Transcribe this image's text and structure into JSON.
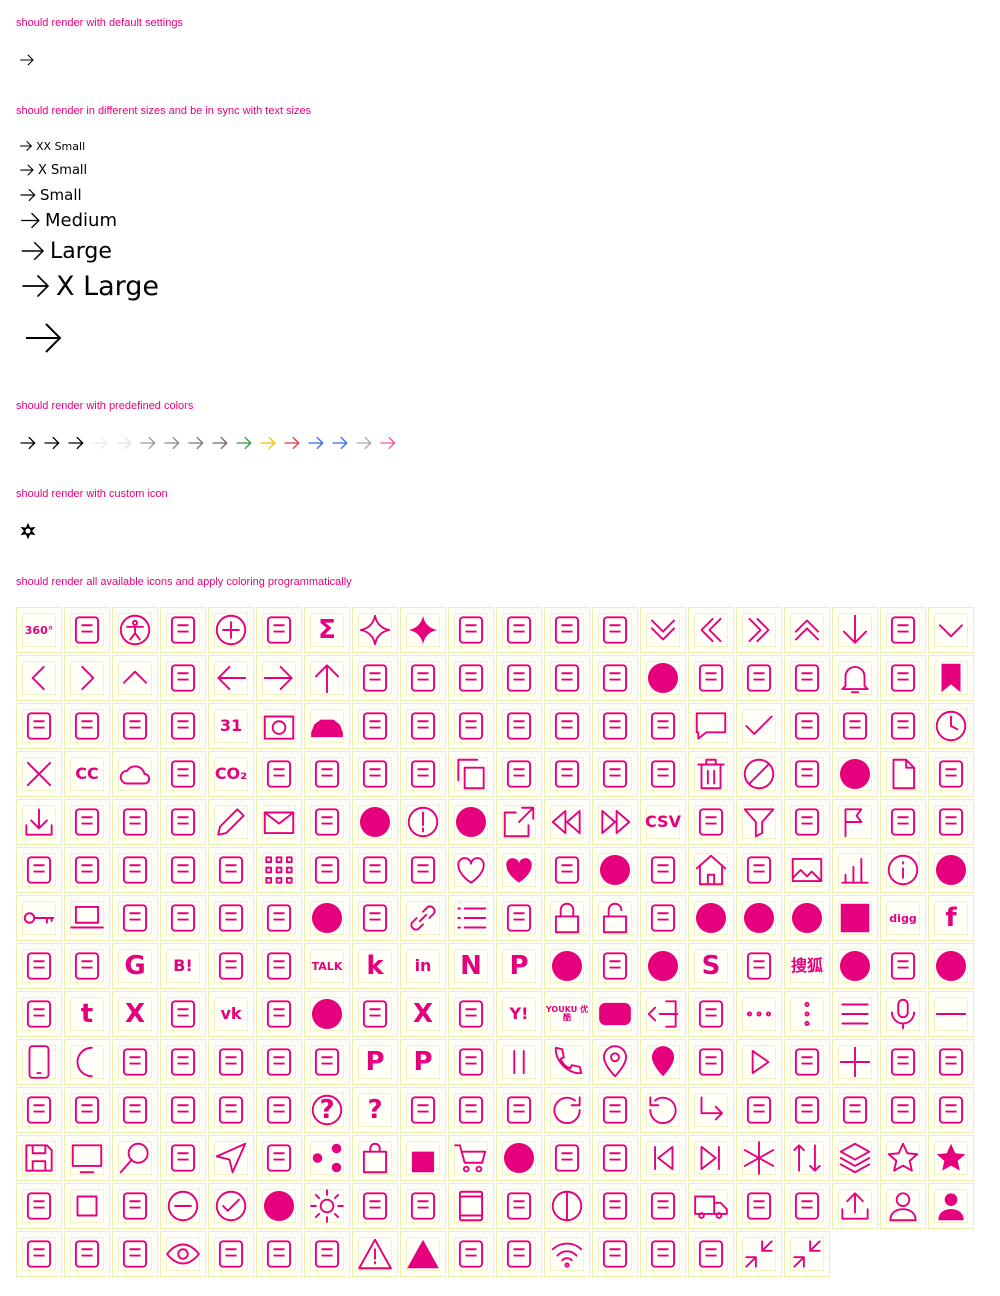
{
  "sections": {
    "default": "should render with default settings",
    "sizes": "should render in different sizes and be in sync with text sizes",
    "colors": "should render with predefined colors",
    "custom": "should render with custom icon",
    "all": "should render all available icons and apply coloring programmatically"
  },
  "size_labels": [
    "XX Small",
    "X Small",
    "Small",
    "Medium",
    "Large",
    "X Large",
    ""
  ],
  "predefined_colors": [
    "#000000",
    "#000000",
    "#000000",
    "#ececec",
    "#e2e2e2",
    "#9a9a9a",
    "#8a8a8a",
    "#7a7a7a",
    "#6a6a6a",
    "#2f9e3c",
    "#e6c700",
    "#e5354b",
    "#2f6bef",
    "#2f6bef",
    "#a9a9a9",
    "#ff4f9a"
  ],
  "accent_color": "#e6007e",
  "icons": [
    {
      "name": "360-icon",
      "text": "360°"
    },
    {
      "name": "accessibility-beam-icon",
      "text": ""
    },
    {
      "name": "accessibility-icon",
      "text": ""
    },
    {
      "name": "air-fan-icon",
      "text": ""
    },
    {
      "name": "add-icon",
      "text": ""
    },
    {
      "name": "adjust-icon",
      "text": ""
    },
    {
      "name": "sigma-icon",
      "text": "Σ"
    },
    {
      "name": "sparkle-icon",
      "text": ""
    },
    {
      "name": "sparkle-filled-icon",
      "text": ""
    },
    {
      "name": "arrow-head-down-icon",
      "text": ""
    },
    {
      "name": "arrow-head-left-icon",
      "text": ""
    },
    {
      "name": "arrow-head-right-icon",
      "text": ""
    },
    {
      "name": "arrow-head-up-icon",
      "text": ""
    },
    {
      "name": "arrow-double-down-icon",
      "text": ""
    },
    {
      "name": "arrow-double-left-icon",
      "text": ""
    },
    {
      "name": "arrow-double-right-icon",
      "text": ""
    },
    {
      "name": "arrow-double-up-icon",
      "text": ""
    },
    {
      "name": "arrow-down-icon",
      "text": ""
    },
    {
      "name": "arrow-first-icon",
      "text": ""
    },
    {
      "name": "arrow-head-down-outline-icon",
      "text": ""
    },
    {
      "name": "arrow-head-left-outline-icon",
      "text": ""
    },
    {
      "name": "arrow-head-right-outline-icon",
      "text": ""
    },
    {
      "name": "arrow-head-up-outline-icon",
      "text": ""
    },
    {
      "name": "arrow-last-icon",
      "text": ""
    },
    {
      "name": "arrow-left-icon",
      "text": ""
    },
    {
      "name": "arrow-right-icon",
      "text": ""
    },
    {
      "name": "arrow-up-icon",
      "text": ""
    },
    {
      "name": "arrows-icon",
      "text": ""
    },
    {
      "name": "attachment-icon",
      "text": ""
    },
    {
      "name": "augmented-reality-icon",
      "text": ""
    },
    {
      "name": "battery-empty-icon",
      "text": ""
    },
    {
      "name": "battery-level-icon",
      "text": ""
    },
    {
      "name": "battery-charging-icon",
      "text": ""
    },
    {
      "name": "battery-full-icon",
      "text": ""
    },
    {
      "name": "battery-half-icon",
      "text": ""
    },
    {
      "name": "battery-one-quarter-icon",
      "text": ""
    },
    {
      "name": "battery-three-quarters-icon",
      "text": ""
    },
    {
      "name": "bell-icon",
      "text": ""
    },
    {
      "name": "bookmark-icon",
      "text": ""
    },
    {
      "name": "bookmark-filled-icon",
      "text": ""
    },
    {
      "name": "brain-icon",
      "text": ""
    },
    {
      "name": "broadcast-icon",
      "text": ""
    },
    {
      "name": "cabriolet-icon",
      "text": ""
    },
    {
      "name": "calculator-icon",
      "text": ""
    },
    {
      "name": "calendar-icon",
      "text": "31"
    },
    {
      "name": "camera-icon",
      "text": ""
    },
    {
      "name": "car-icon",
      "text": ""
    },
    {
      "name": "car-battery-icon",
      "text": ""
    },
    {
      "name": "card-icon",
      "text": ""
    },
    {
      "name": "charging-active-icon",
      "text": ""
    },
    {
      "name": "charging-network-icon",
      "text": ""
    },
    {
      "name": "charging-state-icon",
      "text": ""
    },
    {
      "name": "charging-station-icon",
      "text": ""
    },
    {
      "name": "chart-icon",
      "text": ""
    },
    {
      "name": "chat-icon",
      "text": ""
    },
    {
      "name": "check-icon",
      "text": ""
    },
    {
      "name": "city-icon",
      "text": ""
    },
    {
      "name": "climate-icon",
      "text": ""
    },
    {
      "name": "climate-control-icon",
      "text": ""
    },
    {
      "name": "clock-icon",
      "text": ""
    },
    {
      "name": "close-icon",
      "text": ""
    },
    {
      "name": "closed-caption-icon",
      "text": "CC"
    },
    {
      "name": "cloud-icon",
      "text": ""
    },
    {
      "name": "compare-icon",
      "text": ""
    },
    {
      "name": "co2-emission-icon",
      "text": "CO₂"
    },
    {
      "name": "color-picker-icon",
      "text": ""
    },
    {
      "name": "compare-arrows-icon",
      "text": ""
    },
    {
      "name": "compass-icon",
      "text": ""
    },
    {
      "name": "configurate-icon",
      "text": ""
    },
    {
      "name": "copy-icon",
      "text": ""
    },
    {
      "name": "country-road-icon",
      "text": ""
    },
    {
      "name": "coupe-icon",
      "text": ""
    },
    {
      "name": "cross-icon",
      "text": ""
    },
    {
      "name": "cut-icon",
      "text": ""
    },
    {
      "name": "delete-icon",
      "text": ""
    },
    {
      "name": "disable-icon",
      "text": ""
    },
    {
      "name": "dislike-icon",
      "text": ""
    },
    {
      "name": "dislike-filled-icon",
      "text": ""
    },
    {
      "name": "document-icon",
      "text": ""
    },
    {
      "name": "door-icon",
      "text": ""
    },
    {
      "name": "download-icon",
      "text": ""
    },
    {
      "name": "drag-icon",
      "text": ""
    },
    {
      "name": "duration-icon",
      "text": ""
    },
    {
      "name": "ear-icon",
      "text": ""
    },
    {
      "name": "edit-icon",
      "text": ""
    },
    {
      "name": "email-icon",
      "text": ""
    },
    {
      "name": "error-icon",
      "text": ""
    },
    {
      "name": "error-filled-icon",
      "text": ""
    },
    {
      "name": "exclamation-icon",
      "text": ""
    },
    {
      "name": "exclamation-filled-icon",
      "text": ""
    },
    {
      "name": "external-icon",
      "text": ""
    },
    {
      "name": "fast-backward-icon",
      "text": ""
    },
    {
      "name": "fast-forward-icon",
      "text": ""
    },
    {
      "name": "file-csv-icon",
      "text": "CSV"
    },
    {
      "name": "file-excel-icon",
      "text": ""
    },
    {
      "name": "filter-icon",
      "text": ""
    },
    {
      "name": "fingerprint-icon",
      "text": ""
    },
    {
      "name": "flag-icon",
      "text": ""
    },
    {
      "name": "flash-icon",
      "text": ""
    },
    {
      "name": "fuel-station-icon",
      "text": ""
    },
    {
      "name": "garage-icon",
      "text": ""
    },
    {
      "name": "gift-icon",
      "text": ""
    },
    {
      "name": "geo-localization-icon",
      "text": ""
    },
    {
      "name": "gift-box-icon",
      "text": ""
    },
    {
      "name": "globe-icon",
      "text": ""
    },
    {
      "name": "grid-icon",
      "text": ""
    },
    {
      "name": "grip-icon",
      "text": ""
    },
    {
      "name": "group-icon",
      "text": ""
    },
    {
      "name": "hand-icon",
      "text": ""
    },
    {
      "name": "heart-icon",
      "text": ""
    },
    {
      "name": "heart-filled-icon",
      "text": ""
    },
    {
      "name": "highway-icon",
      "text": ""
    },
    {
      "name": "highway-filled-icon",
      "text": ""
    },
    {
      "name": "history-icon",
      "text": ""
    },
    {
      "name": "home-icon",
      "text": ""
    },
    {
      "name": "horn-icon",
      "text": ""
    },
    {
      "name": "image-icon",
      "text": ""
    },
    {
      "name": "increase-icon",
      "text": ""
    },
    {
      "name": "information-icon",
      "text": ""
    },
    {
      "name": "information-filled-icon",
      "text": ""
    },
    {
      "name": "key-icon",
      "text": ""
    },
    {
      "name": "laptop-icon",
      "text": ""
    },
    {
      "name": "leaf-icon",
      "text": ""
    },
    {
      "name": "leather-icon",
      "text": ""
    },
    {
      "name": "light-icon",
      "text": ""
    },
    {
      "name": "like-icon",
      "text": ""
    },
    {
      "name": "like-filled-icon",
      "text": ""
    },
    {
      "name": "limousine-icon",
      "text": ""
    },
    {
      "name": "link-icon",
      "text": ""
    },
    {
      "name": "list-icon",
      "text": ""
    },
    {
      "name": "locate-icon",
      "text": ""
    },
    {
      "name": "lock-icon",
      "text": ""
    },
    {
      "name": "lock-open-icon",
      "text": ""
    },
    {
      "name": "logo-delicious-icon",
      "text": ""
    },
    {
      "name": "logo-apple-music-icon",
      "text": ""
    },
    {
      "name": "logo-apple-podcast-icon",
      "text": ""
    },
    {
      "name": "logo-baidu-icon",
      "text": ""
    },
    {
      "name": "logo-delicious-squares-icon",
      "text": ""
    },
    {
      "name": "logo-digg-icon",
      "text": "digg"
    },
    {
      "name": "logo-facebook-icon",
      "text": "f"
    },
    {
      "name": "logo-foursquare-icon",
      "text": ""
    },
    {
      "name": "logo-gmail-icon",
      "text": ""
    },
    {
      "name": "logo-google-icon",
      "text": "G"
    },
    {
      "name": "logo-hatena-icon",
      "text": "B!"
    },
    {
      "name": "logo-instagram-icon",
      "text": ""
    },
    {
      "name": "logo-kaixin-icon",
      "text": ""
    },
    {
      "name": "logo-kakaotalk-icon",
      "text": "TALK"
    },
    {
      "name": "logo-kununu-icon",
      "text": "k"
    },
    {
      "name": "logo-linkedin-icon",
      "text": "in"
    },
    {
      "name": "logo-naver-icon",
      "text": "N"
    },
    {
      "name": "logo-pinterest-icon",
      "text": "P"
    },
    {
      "name": "logo-qq-icon",
      "text": ""
    },
    {
      "name": "logo-qq-share-icon",
      "text": ""
    },
    {
      "name": "logo-reddit-icon",
      "text": ""
    },
    {
      "name": "logo-skyrock-icon",
      "text": "S"
    },
    {
      "name": "logo-snapchat-icon",
      "text": ""
    },
    {
      "name": "logo-sohu-icon",
      "text": "搜狐"
    },
    {
      "name": "logo-spotify-icon",
      "text": ""
    },
    {
      "name": "logo-tecent-icon",
      "text": ""
    },
    {
      "name": "logo-telegram-icon",
      "text": ""
    },
    {
      "name": "logo-tiktok-icon",
      "text": ""
    },
    {
      "name": "logo-tumblr-icon",
      "text": "t"
    },
    {
      "name": "logo-twitter-icon",
      "text": "X"
    },
    {
      "name": "logo-viber-icon",
      "text": ""
    },
    {
      "name": "logo-vk-icon",
      "text": "vk"
    },
    {
      "name": "logo-wechat-icon",
      "text": ""
    },
    {
      "name": "logo-weibo-icon",
      "text": ""
    },
    {
      "name": "logo-whatsapp-icon",
      "text": ""
    },
    {
      "name": "logo-x-icon",
      "text": "X"
    },
    {
      "name": "logo-xing-icon",
      "text": ""
    },
    {
      "name": "logo-yahoo-icon",
      "text": "Y!"
    },
    {
      "name": "logo-youku-icon",
      "text": "YOUKU 优酷"
    },
    {
      "name": "logo-youtube-icon",
      "text": ""
    },
    {
      "name": "logout-icon",
      "text": ""
    },
    {
      "name": "map-icon",
      "text": ""
    },
    {
      "name": "more-horizontal-icon",
      "text": ""
    },
    {
      "name": "more-vertical-icon",
      "text": ""
    },
    {
      "name": "menu-lines-icon",
      "text": ""
    },
    {
      "name": "microphone-icon",
      "text": ""
    },
    {
      "name": "minus-icon",
      "text": ""
    },
    {
      "name": "mobile-icon",
      "text": ""
    },
    {
      "name": "moon-icon",
      "text": ""
    },
    {
      "name": "new-chat-icon",
      "text": ""
    },
    {
      "name": "news-icon",
      "text": ""
    },
    {
      "name": "north-arrow-icon",
      "text": ""
    },
    {
      "name": "oil-can-icon",
      "text": ""
    },
    {
      "name": "online-service-icon",
      "text": ""
    },
    {
      "name": "parking-brake-icon",
      "text": "P"
    },
    {
      "name": "parking-light-icon",
      "text": "P"
    },
    {
      "name": "paste-icon",
      "text": ""
    },
    {
      "name": "pause-icon",
      "text": ""
    },
    {
      "name": "phone-icon",
      "text": ""
    },
    {
      "name": "pin-icon",
      "text": ""
    },
    {
      "name": "pin-filled-icon",
      "text": ""
    },
    {
      "name": "pivot-icon",
      "text": ""
    },
    {
      "name": "play-icon",
      "text": ""
    },
    {
      "name": "plug-icon",
      "text": ""
    },
    {
      "name": "plus-icon",
      "text": ""
    },
    {
      "name": "rear-window-heating-icon",
      "text": ""
    },
    {
      "name": "price-tag-icon",
      "text": ""
    },
    {
      "name": "printer-icon",
      "text": ""
    },
    {
      "name": "purchase-icon",
      "text": ""
    },
    {
      "name": "push-pin-icon",
      "text": ""
    },
    {
      "name": "push-pin-off-icon",
      "text": ""
    },
    {
      "name": "qr-icon",
      "text": ""
    },
    {
      "name": "qr-off-icon",
      "text": ""
    },
    {
      "name": "question-icon",
      "text": "?"
    },
    {
      "name": "question-filled-icon",
      "text": "?"
    },
    {
      "name": "race-flag-icon",
      "text": ""
    },
    {
      "name": "radar-icon",
      "text": ""
    },
    {
      "name": "radio-icon",
      "text": ""
    },
    {
      "name": "refresh-icon",
      "text": ""
    },
    {
      "name": "replay-icon",
      "text": ""
    },
    {
      "name": "reset-icon",
      "text": ""
    },
    {
      "name": "return-icon",
      "text": ""
    },
    {
      "name": "road-icon",
      "text": ""
    },
    {
      "name": "roadside-assistant-icon",
      "text": ""
    },
    {
      "name": "route-car-icon",
      "text": ""
    },
    {
      "name": "route-icon",
      "text": ""
    },
    {
      "name": "rss-icon",
      "text": ""
    },
    {
      "name": "save-icon",
      "text": ""
    },
    {
      "name": "screen-icon",
      "text": ""
    },
    {
      "name": "search-icon",
      "text": ""
    },
    {
      "name": "seat-icon",
      "text": ""
    },
    {
      "name": "send-icon",
      "text": ""
    },
    {
      "name": "service-technician-icon",
      "text": ""
    },
    {
      "name": "share-icon",
      "text": ""
    },
    {
      "name": "shopping-bag-icon",
      "text": ""
    },
    {
      "name": "shopping-bag-filled-icon",
      "text": ""
    },
    {
      "name": "shopping-cart-icon",
      "text": ""
    },
    {
      "name": "shopping-cart-filled-icon",
      "text": ""
    },
    {
      "name": "sidebar-icon",
      "text": ""
    },
    {
      "name": "sidelights-icon",
      "text": ""
    },
    {
      "name": "skip-backward-icon",
      "text": ""
    },
    {
      "name": "skip-forward-icon",
      "text": ""
    },
    {
      "name": "snowflake-icon",
      "text": ""
    },
    {
      "name": "sort-icon",
      "text": ""
    },
    {
      "name": "stack-icon",
      "text": ""
    },
    {
      "name": "star-icon",
      "text": ""
    },
    {
      "name": "star-filled-icon",
      "text": ""
    },
    {
      "name": "steering-wheel-icon",
      "text": ""
    },
    {
      "name": "stop-icon",
      "text": ""
    },
    {
      "name": "stopwatch-icon",
      "text": ""
    },
    {
      "name": "subtract-icon",
      "text": ""
    },
    {
      "name": "success-icon",
      "text": ""
    },
    {
      "name": "success-filled-icon",
      "text": ""
    },
    {
      "name": "sun-icon",
      "text": ""
    },
    {
      "name": "suv-icon",
      "text": ""
    },
    {
      "name": "switch-icon",
      "text": ""
    },
    {
      "name": "tablet-icon",
      "text": ""
    },
    {
      "name": "tachometer-icon",
      "text": ""
    },
    {
      "name": "theme-icon",
      "text": ""
    },
    {
      "name": "tire-icon",
      "text": ""
    },
    {
      "name": "touch-icon",
      "text": ""
    },
    {
      "name": "truck-icon",
      "text": ""
    },
    {
      "name": "turismo-icon",
      "text": ""
    },
    {
      "name": "unlink-icon",
      "text": ""
    },
    {
      "name": "upload-icon",
      "text": ""
    },
    {
      "name": "user-icon",
      "text": ""
    },
    {
      "name": "user-filled-icon",
      "text": ""
    },
    {
      "name": "user-manual-icon",
      "text": ""
    },
    {
      "name": "user-manual-book-icon",
      "text": ""
    },
    {
      "name": "video-icon",
      "text": ""
    },
    {
      "name": "view-icon",
      "text": ""
    },
    {
      "name": "view-off-icon",
      "text": ""
    },
    {
      "name": "volume-off-icon",
      "text": ""
    },
    {
      "name": "volume-up-icon",
      "text": ""
    },
    {
      "name": "warning-icon",
      "text": ""
    },
    {
      "name": "warning-filled-icon",
      "text": ""
    },
    {
      "name": "weather-icon",
      "text": ""
    },
    {
      "name": "weight-icon",
      "text": ""
    },
    {
      "name": "wifi-icon",
      "text": ""
    },
    {
      "name": "work-icon",
      "text": ""
    },
    {
      "name": "wrench-icon",
      "text": ""
    },
    {
      "name": "wrenches-icon",
      "text": ""
    },
    {
      "name": "zoom-in-icon",
      "text": ""
    },
    {
      "name": "zoom-out-icon",
      "text": ""
    }
  ]
}
